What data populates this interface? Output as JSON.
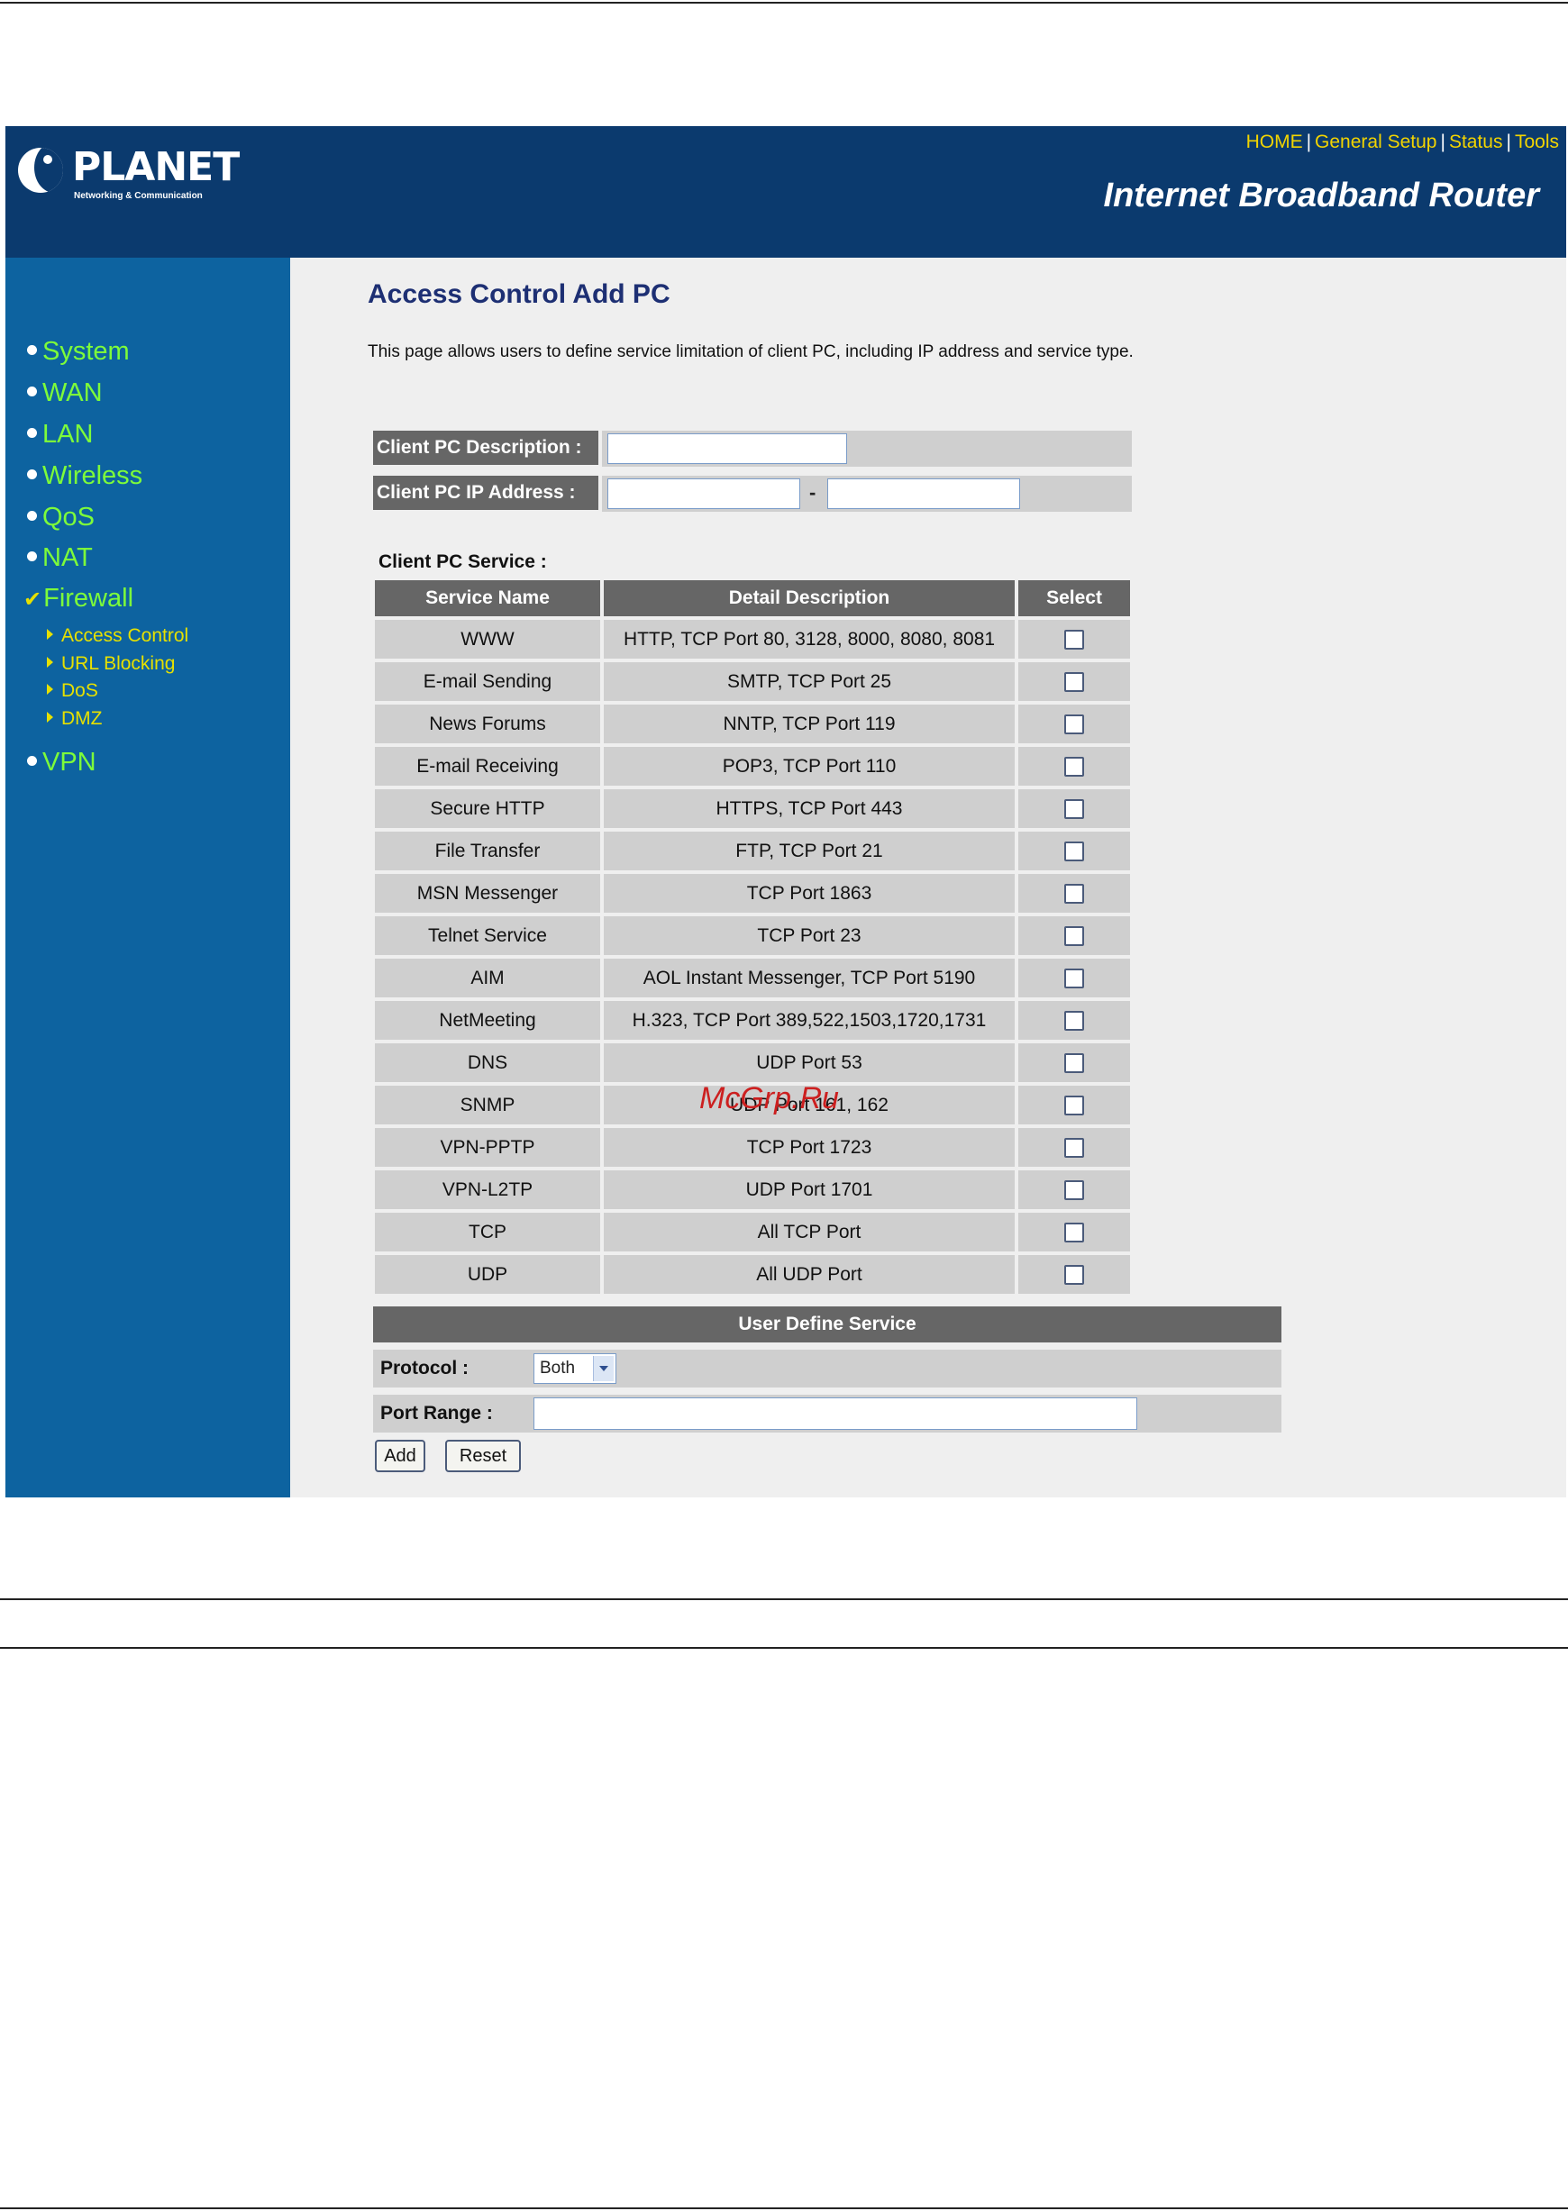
{
  "header": {
    "brand": "PLANET",
    "tagline": "Networking & Communication",
    "nav": [
      "HOME",
      "General Setup",
      "Status",
      "Tools"
    ],
    "router_title": "Internet Broadband Router"
  },
  "sidebar": {
    "items": [
      "System",
      "WAN",
      "LAN",
      "Wireless",
      "QoS",
      "NAT",
      "Firewall",
      "VPN"
    ],
    "firewall_sub": [
      "Access Control",
      "URL Blocking",
      "DoS",
      "DMZ"
    ]
  },
  "main": {
    "title": "Access Control Add PC",
    "description": "This page allows users to define service limitation of client PC, including IP address and service type.",
    "client_desc_label": "Client PC Description :",
    "client_ip_label": "Client PC IP Address :",
    "ip_separator": "-",
    "client_desc_value": "",
    "ip_start_value": "",
    "ip_end_value": "",
    "service_heading": "Client PC Service :",
    "table_headers": [
      "Service Name",
      "Detail Description",
      "Select"
    ],
    "services": [
      {
        "name": "WWW",
        "detail": "HTTP, TCP Port 80, 3128, 8000, 8080, 8081"
      },
      {
        "name": "E-mail Sending",
        "detail": "SMTP, TCP Port 25"
      },
      {
        "name": "News Forums",
        "detail": "NNTP, TCP Port 119"
      },
      {
        "name": "E-mail Receiving",
        "detail": "POP3, TCP Port 110"
      },
      {
        "name": "Secure HTTP",
        "detail": "HTTPS, TCP Port 443"
      },
      {
        "name": "File Transfer",
        "detail": "FTP, TCP Port 21"
      },
      {
        "name": "MSN Messenger",
        "detail": "TCP Port 1863"
      },
      {
        "name": "Telnet Service",
        "detail": "TCP Port 23"
      },
      {
        "name": "AIM",
        "detail": "AOL Instant Messenger, TCP Port 5190"
      },
      {
        "name": "NetMeeting",
        "detail": "H.323, TCP Port 389,522,1503,1720,1731"
      },
      {
        "name": "DNS",
        "detail": "UDP Port 53"
      },
      {
        "name": "SNMP",
        "detail": "UDP Port 161, 162"
      },
      {
        "name": "VPN-PPTP",
        "detail": "TCP Port 1723"
      },
      {
        "name": "VPN-L2TP",
        "detail": "UDP Port 1701"
      },
      {
        "name": "TCP",
        "detail": "All TCP Port"
      },
      {
        "name": "UDP",
        "detail": "All UDP Port"
      }
    ],
    "user_define_heading": "User Define Service",
    "protocol_label": "Protocol :",
    "protocol_value": "Both",
    "port_range_label": "Port Range :",
    "port_range_value": "",
    "add_label": "Add",
    "reset_label": "Reset"
  },
  "watermark": "McGrp.Ru"
}
